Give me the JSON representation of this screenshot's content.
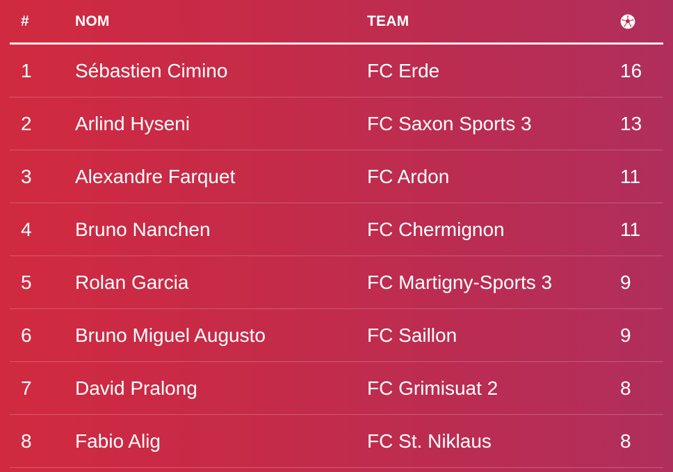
{
  "header": {
    "rank": "#",
    "name": "NOM",
    "team": "TEAM",
    "goals_icon": "soccer-ball-icon"
  },
  "rows": [
    {
      "rank": "1",
      "name": "Sébastien Cimino",
      "team": "FC Erde",
      "goals": "16"
    },
    {
      "rank": "2",
      "name": "Arlind Hyseni",
      "team": "FC Saxon Sports 3",
      "goals": "13"
    },
    {
      "rank": "3",
      "name": "Alexandre Farquet",
      "team": "FC Ardon",
      "goals": "11"
    },
    {
      "rank": "4",
      "name": "Bruno Nanchen",
      "team": "FC Chermignon",
      "goals": "11"
    },
    {
      "rank": "5",
      "name": "Rolan Garcia",
      "team": "FC Martigny-Sports 3",
      "goals": "9"
    },
    {
      "rank": "6",
      "name": "Bruno Miguel Augusto",
      "team": "FC Saillon",
      "goals": "9"
    },
    {
      "rank": "7",
      "name": "David Pralong",
      "team": "FC Grimisuat 2",
      "goals": "8"
    },
    {
      "rank": "8",
      "name": "Fabio Alig",
      "team": "FC St. Niklaus",
      "goals": "8"
    }
  ],
  "colors": {
    "gradient_start": "#d12a40",
    "gradient_end": "#b02e5c",
    "text": "#ffffff"
  }
}
